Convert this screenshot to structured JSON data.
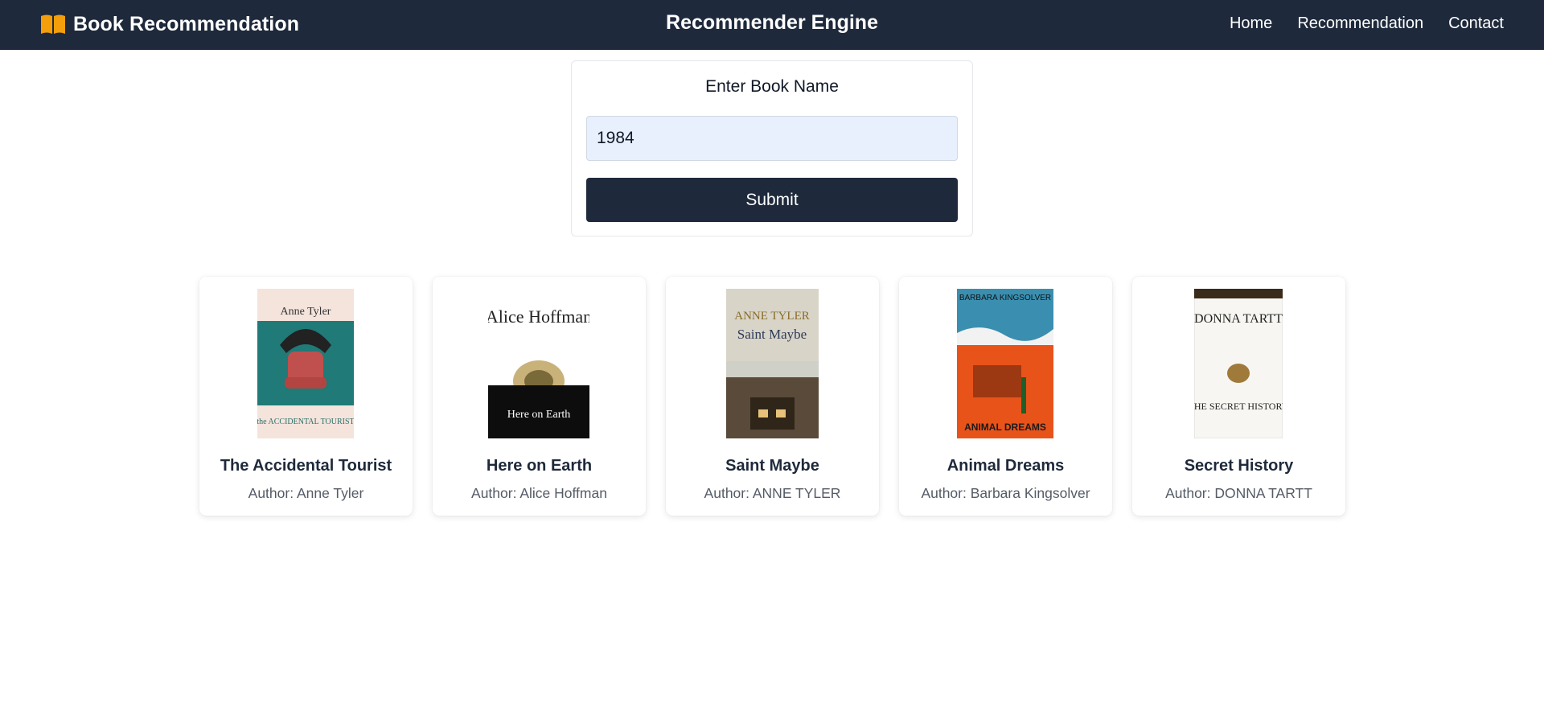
{
  "nav": {
    "brand": "Book Recommendation",
    "brand_icon": "open-book-icon",
    "center_title": "Recommender Engine",
    "links": [
      "Home",
      "Recommendation",
      "Contact"
    ],
    "colors": {
      "bar": "#1e293b",
      "icon": "#f59e0b"
    }
  },
  "search": {
    "label": "Enter Book Name",
    "value": "1984",
    "submit_label": "Submit"
  },
  "books": [
    {
      "title": "The Accidental Tourist",
      "author": "Author: Anne Tyler",
      "cover": {
        "top_text": "Anne Tyler",
        "bottom_text": "the ACCIDENTAL TOURIST"
      }
    },
    {
      "title": "Here on Earth",
      "author": "Author: Alice Hoffman",
      "cover": {
        "top_text": "Alice Hoffman",
        "bottom_text": "Here on Earth"
      }
    },
    {
      "title": "Saint Maybe",
      "author": "Author: ANNE TYLER",
      "cover": {
        "top_text": "ANNE TYLER",
        "bottom_text": "Saint Maybe"
      }
    },
    {
      "title": "Animal Dreams",
      "author": "Author: Barbara Kingsolver",
      "cover": {
        "top_text": "BARBARA KINGSOLVER",
        "bottom_text": "ANIMAL DREAMS"
      }
    },
    {
      "title": "Secret History",
      "author": "Author: DONNA TARTT",
      "cover": {
        "top_text": "DONNA TARTT",
        "bottom_text": "THE SECRET HISTORY"
      }
    }
  ]
}
